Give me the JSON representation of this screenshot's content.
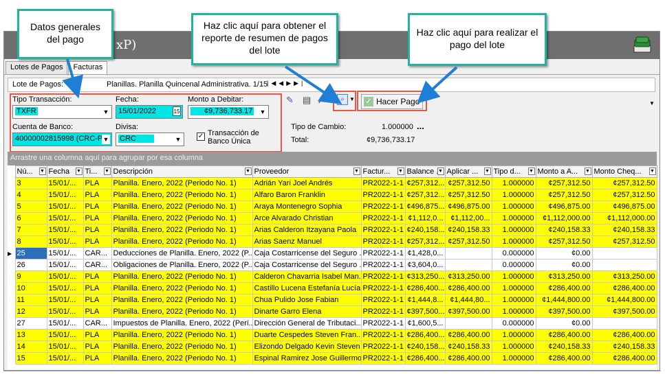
{
  "window": {
    "title_fragment": "xP)"
  },
  "tabs": [
    {
      "label": "Lotes de Pagos"
    },
    {
      "label": "Facturas"
    }
  ],
  "lote": {
    "label": "Lote de Pagos:",
    "name": "Planillas.  Planilla Quincenal Administrativa. 1/15"
  },
  "form": {
    "tipo_label": "Tipo Transacción:",
    "tipo_value": "TXFR",
    "fecha_label": "Fecha:",
    "fecha_value": "15/01/2022",
    "monto_label": "Monto a Debitar:",
    "monto_value": "¢9,736,733.17",
    "cuenta_label": "Cuenta de Banco:",
    "cuenta_value": "40000002815998 (CRC-P",
    "divisa_label": "Divisa:",
    "divisa_value": "CRC",
    "unica_label": "Transacción de Banco Única",
    "calendar_day": "15"
  },
  "pay_button": {
    "label": "Hacer Pago"
  },
  "tipo_cambio": {
    "label": "Tipo de Cambio:",
    "value": "1.000000",
    "more": "..."
  },
  "total": {
    "label": "Total:",
    "value": "¢9,736,733.17"
  },
  "grid": {
    "group_hint": "Arrastre una columna aquí para agrupar por esa columna",
    "columns": [
      "Nú...",
      "Fecha",
      "Ti...",
      "Descripción",
      "Proveedor",
      "Factur...",
      "Balance ...",
      "Aplicar ...",
      "Tipo d...",
      "Monto a A...",
      "Monto Cheq..."
    ],
    "rows": [
      {
        "c": [
          "3",
          "15/01/...",
          "PLA",
          "Planilla.  Enero, 2022 (Periodo No. 1)",
          "Adrián Yari Joel Andrés",
          "PR2022-1-1",
          "¢257,312...",
          "¢257,312.50",
          "1.000000",
          "¢257,312.50",
          "¢257,312.50"
        ],
        "y": true
      },
      {
        "c": [
          "4",
          "15/01/...",
          "PLA",
          "Planilla.  Enero, 2022 (Periodo No. 1)",
          "Alfaro Baron Franklin",
          "PR2022-1-1",
          "¢257,312...",
          "¢257,312.50",
          "1.000000",
          "¢257,312.50",
          "¢257,312.50"
        ],
        "y": true
      },
      {
        "c": [
          "5",
          "15/01/...",
          "PLA",
          "Planilla.  Enero, 2022 (Periodo No. 1)",
          "Araya Montenegro Sophia",
          "PR2022-1-1",
          "¢496,875...",
          "¢496,875.00",
          "1.000000",
          "¢496,875.00",
          "¢496,875.00"
        ],
        "y": true
      },
      {
        "c": [
          "6",
          "15/01/...",
          "PLA",
          "Planilla.  Enero, 2022 (Periodo No. 1)",
          "Arce Alvarado Christian",
          "PR2022-1-1",
          "¢1,112,0...",
          "¢1,112,00...",
          "1.000000",
          "¢1,112,000.00",
          "¢1,112,000.00"
        ],
        "y": true
      },
      {
        "c": [
          "7",
          "15/01/...",
          "PLA",
          "Planilla.  Enero, 2022 (Periodo No. 1)",
          "Arias Calderon Itzayana Paola",
          "PR2022-1-1",
          "¢240,158...",
          "¢240,158.33",
          "1.000000",
          "¢240,158.33",
          "¢240,158.33"
        ],
        "y": true
      },
      {
        "c": [
          "8",
          "15/01/...",
          "PLA",
          "Planilla.  Enero, 2022 (Periodo No. 1)",
          "Arias Saenz Manuel",
          "PR2022-1-1",
          "¢257,312...",
          "¢257,312.50",
          "1.000000",
          "¢257,312.50",
          "¢257,312.50"
        ],
        "y": true
      },
      {
        "c": [
          "25",
          "15/01/...",
          "CAR...",
          "Deducciones de Planilla. Enero, 2022 (P...",
          "Caja Costarricense del Seguro ...",
          "PR2022-1-1",
          "¢1,428,0...",
          "",
          "0.000000",
          "¢0.00",
          ""
        ],
        "y": false,
        "sel": true
      },
      {
        "c": [
          "26",
          "15/01/...",
          "CAR...",
          "Obligaciones de Planilla. Enero, 2022 (P...",
          "Caja Costarricense del Seguro ...",
          "PR2022-1-1",
          "¢3,604,0...",
          "",
          "0.000000",
          "¢0.00",
          ""
        ],
        "y": false
      },
      {
        "c": [
          "9",
          "15/01/...",
          "PLA",
          "Planilla.  Enero, 2022 (Periodo No. 1)",
          "Calderon Chavarria Isabel Man...",
          "PR2022-1-1",
          "¢313,250...",
          "¢313,250.00",
          "1.000000",
          "¢313,250.00",
          "¢313,250.00"
        ],
        "y": true
      },
      {
        "c": [
          "10",
          "15/01/...",
          "PLA",
          "Planilla.  Enero, 2022 (Periodo No. 1)",
          "Castillo Lucena Estefanía Lucía",
          "PR2022-1-1",
          "¢286,400...",
          "¢286,400.00",
          "1.000000",
          "¢286,400.00",
          "¢286,400.00"
        ],
        "y": true
      },
      {
        "c": [
          "11",
          "15/01/...",
          "PLA",
          "Planilla.  Enero, 2022 (Periodo No. 1)",
          "Chua Pulido Jose Fabian",
          "PR2022-1-1",
          "¢1,444,8...",
          "¢1,444,80...",
          "1.000000",
          "¢1,444,800.00",
          "¢1,444,800.00"
        ],
        "y": true
      },
      {
        "c": [
          "12",
          "15/01/...",
          "PLA",
          "Planilla.  Enero, 2022 (Periodo No. 1)",
          "Dinarte Garro Elena",
          "PR2022-1-1",
          "¢397,500...",
          "¢397,500.00",
          "1.000000",
          "¢397,500.00",
          "¢397,500.00"
        ],
        "y": true
      },
      {
        "c": [
          "27",
          "15/01/...",
          "CAR...",
          "Impuestos de Planilla. Enero, 2022 (Peri...",
          "Dirección General de Tributaci...",
          "PR2022-1-1",
          "¢1,600,5...",
          "",
          "0.000000",
          "¢0.00",
          ""
        ],
        "y": false
      },
      {
        "c": [
          "13",
          "15/01/...",
          "PLA",
          "Planilla.  Enero, 2022 (Periodo No. 1)",
          "Duarte Cespedes Steven Fran...",
          "PR2022-1-1",
          "¢286,400...",
          "¢286,400.00",
          "1.000000",
          "¢286,400.00",
          "¢286,400.00"
        ],
        "y": true
      },
      {
        "c": [
          "14",
          "15/01/...",
          "PLA",
          "Planilla.  Enero, 2022 (Periodo No. 1)",
          "Elizondo Delgado  Kevin Steven",
          "PR2022-1-1",
          "¢240,158...",
          "¢240,158.33",
          "1.000000",
          "¢240,158.33",
          "¢240,158.33"
        ],
        "y": true
      },
      {
        "c": [
          "15",
          "15/01/...",
          "PLA",
          "Planilla.  Enero, 2022 (Periodo No. 1)",
          "Espinal Ramirez Jose Guillermo",
          "PR2022-1-1",
          "¢286,400...",
          "¢286,400.00",
          "1.000000",
          "¢286,400.00",
          "¢286,400.00"
        ],
        "y": true
      }
    ]
  },
  "callouts": {
    "datos": "Datos generales del pago",
    "reporte": "Haz clic aquí para obtener el reporte de resumen de pagos del lote",
    "pago": "Haz clic aquí para realizar el pago del lote"
  },
  "colors": {
    "highlight": "#ffff00",
    "callout_border": "#20b4a0",
    "annotation_red": "#e8584a",
    "arrow": "#1f7fd6",
    "field_selection": "#00e5e5"
  }
}
